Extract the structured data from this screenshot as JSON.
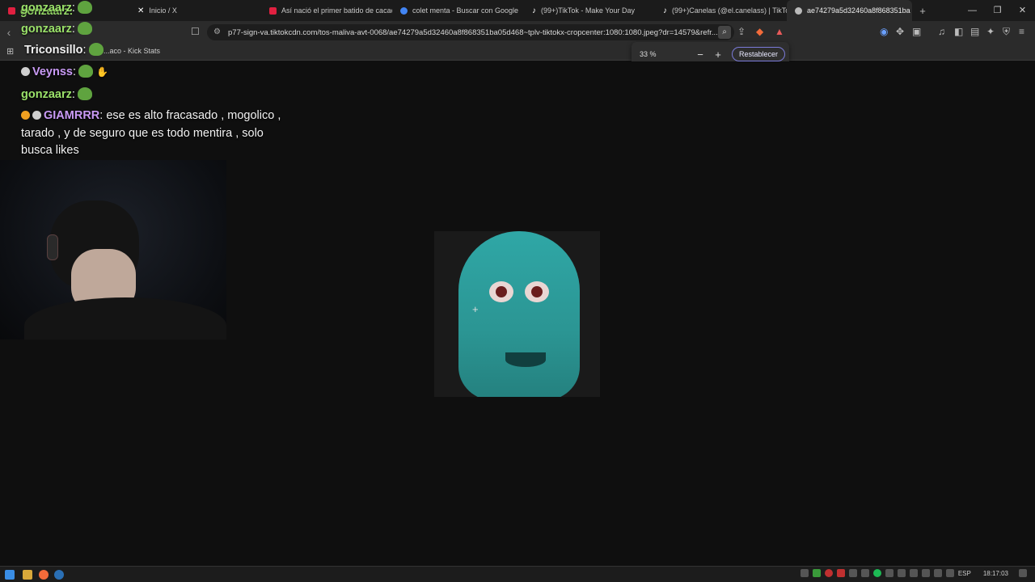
{
  "tabs": [
    {
      "title": "gonzaarz:",
      "favicon_color": "#e02040",
      "active": false
    },
    {
      "title": "Inicio / X",
      "favicon_color": "#ffffff",
      "active": false
    },
    {
      "title": "Así nació el primer batido de cacao",
      "favicon_color": "#e02040",
      "active": false
    },
    {
      "title": "colet menta - Buscar con Google",
      "favicon_color": "#4285f4",
      "active": false
    },
    {
      "title": "(99+)TikTok - Make Your Day",
      "favicon_color": "#ffffff",
      "active": false
    },
    {
      "title": "(99+)Canelas (@el.canelass) | TikTok",
      "favicon_color": "#ffffff",
      "active": false
    },
    {
      "title": "ae74279a5d32460a8f868351ba",
      "favicon_color": "#bbbbbb",
      "active": true
    }
  ],
  "address": {
    "url": "p77-sign-va.tiktokcdn.com/tos-maliva-avt-0068/ae74279a5d32460a8f868351ba05d468~tplv-tiktokx-cropcenter:1080:1080.jpeg?dr=14579&refr..."
  },
  "bookmarks": {
    "item": "...aco - Kick Stats"
  },
  "zoom": {
    "percent": "33 %",
    "minus": "−",
    "plus": "+",
    "reset_label": "Restablecer"
  },
  "chat": {
    "top_lines": [
      {
        "user": "gonzaarz",
        "sep": ":"
      },
      {
        "user": "gonzaarz",
        "sep": ":"
      },
      {
        "user": "Triconsillo",
        "sep": ":"
      }
    ],
    "messages": [
      {
        "user": "Veynss",
        "sep": ":",
        "text": ""
      },
      {
        "user": "gonzaarz",
        "sep": ":",
        "text": ""
      },
      {
        "user": "GIAMRRR",
        "sep": ":",
        "text": " ese es alto fracasado , mogolico , tarado , y de seguro que es todo mentira , solo busca likes"
      }
    ]
  },
  "taskbar": {
    "lang": "ESP",
    "time": "18:17:03"
  },
  "colors": {
    "accent": "#7b7bd9",
    "chat_green": "#9be26a",
    "chat_purple": "#c99af5"
  }
}
